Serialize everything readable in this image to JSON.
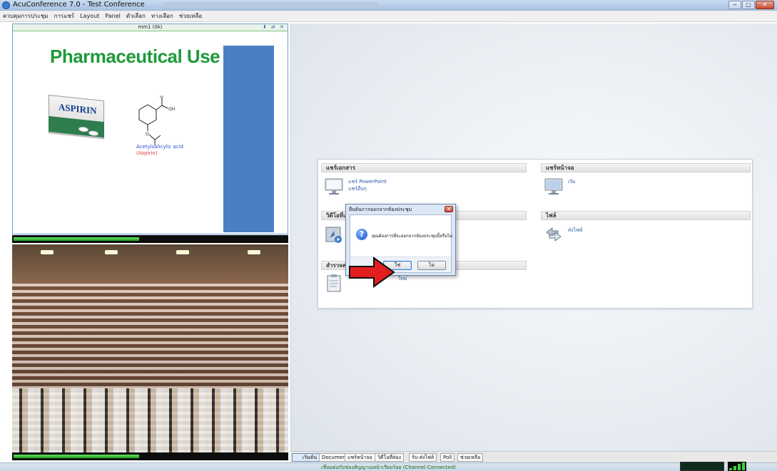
{
  "window": {
    "title": "AcuConference 7.0 - Test Conference",
    "controls": [
      "−",
      "□",
      "✕"
    ]
  },
  "menu": [
    "ควบคุมการประชุม",
    "การแชร์",
    "Layout",
    "Panel",
    "ตัวเลือก",
    "ทางเลือก",
    "ช่วยเหลือ"
  ],
  "slide": {
    "header": "mm1 (0k)",
    "header_icons": "⬇ ⇄ ✕",
    "title": "Pharmaceutical Use",
    "box_brand": "ASPIRIN",
    "caption_line1": "Acetylsalicylic acid",
    "caption_line2": "(Aspirin)",
    "accent_color": "#1d9a3a",
    "block_color": "#4b7fc4"
  },
  "progress": {
    "slide_fill": 0.46,
    "video_fill": 0.46
  },
  "welcome": {
    "share_docs": {
      "heading": "แชร์เอกสาร",
      "link1": "แชร์ PowerPoint",
      "link2": "แชร์อื่นๆ"
    },
    "share_screen": {
      "heading": "แชร์หน้าจอ",
      "link1": "เริ่ม"
    },
    "video_files": {
      "heading": "วิดีโอที่แ"
    },
    "files": {
      "heading": "ไฟล์",
      "link1": "ส่งไฟล์"
    },
    "survey": {
      "heading": "สำรวจค",
      "link1": "ใหม่"
    }
  },
  "dialog": {
    "title": "ยืนยันการออกจากห้องประชุม",
    "close": "✕",
    "message": "คุณต้องการที่จะออกจากห้องประชุมนี้หรือไม่",
    "yes": "ใช่",
    "no": "ไม่"
  },
  "tabs": [
    "เริ่มต้น",
    "Document",
    "แชร์หน้าจอ",
    "วิดีโอที่ส่อง",
    "รับ-ส่งไฟล์",
    "Poll",
    "ช่วยเหลือ"
  ],
  "status": {
    "text": "เชื่อมต่อกับช่องสัญญาณหน้าเรียบร้อย (Channel Connected)"
  }
}
